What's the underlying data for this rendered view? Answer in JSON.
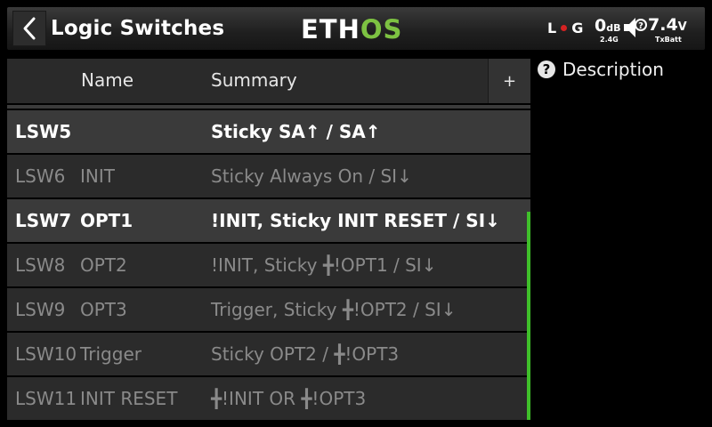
{
  "header": {
    "title": "Logic Switches",
    "logo_part1": "ETH",
    "logo_part2": "OS",
    "status": {
      "left_label": "L",
      "right_label": "G",
      "rssi": "0",
      "rssi_unit": "dB",
      "band": "2.4G",
      "voltage": "7.4",
      "voltage_unit": "V",
      "voltage_label": "TxBatt"
    }
  },
  "table": {
    "columns": {
      "name": "Name",
      "summary": "Summary"
    },
    "add_label": "+",
    "rows": [
      {
        "id": "LSW5",
        "name": "",
        "summary": "Sticky SA↑ / SA↑",
        "active": true
      },
      {
        "id": "LSW6",
        "name": "INIT",
        "summary": "Sticky Always On / SI↓",
        "active": false
      },
      {
        "id": "LSW7",
        "name": "OPT1",
        "summary": "!INIT, Sticky INIT RESET / SI↓",
        "active": true
      },
      {
        "id": "LSW8",
        "name": "OPT2",
        "summary": "!INIT, Sticky ╋!OPT1 / SI↓",
        "active": false
      },
      {
        "id": "LSW9",
        "name": "OPT3",
        "summary": "Trigger, Sticky ╋!OPT2 / SI↓",
        "active": false
      },
      {
        "id": "LSW10",
        "name": "Trigger",
        "summary": "Sticky OPT2 / ╋!OPT3",
        "active": false
      },
      {
        "id": "LSW11",
        "name": "INIT RESET",
        "summary": "╋!INIT OR ╋!OPT3",
        "active": false
      }
    ]
  },
  "panel": {
    "help_glyph": "?",
    "description_label": "Description"
  },
  "colors": {
    "accent_green": "#7dc242",
    "scrollbar": "#3fbf2a",
    "status_dot": "#d52222"
  }
}
